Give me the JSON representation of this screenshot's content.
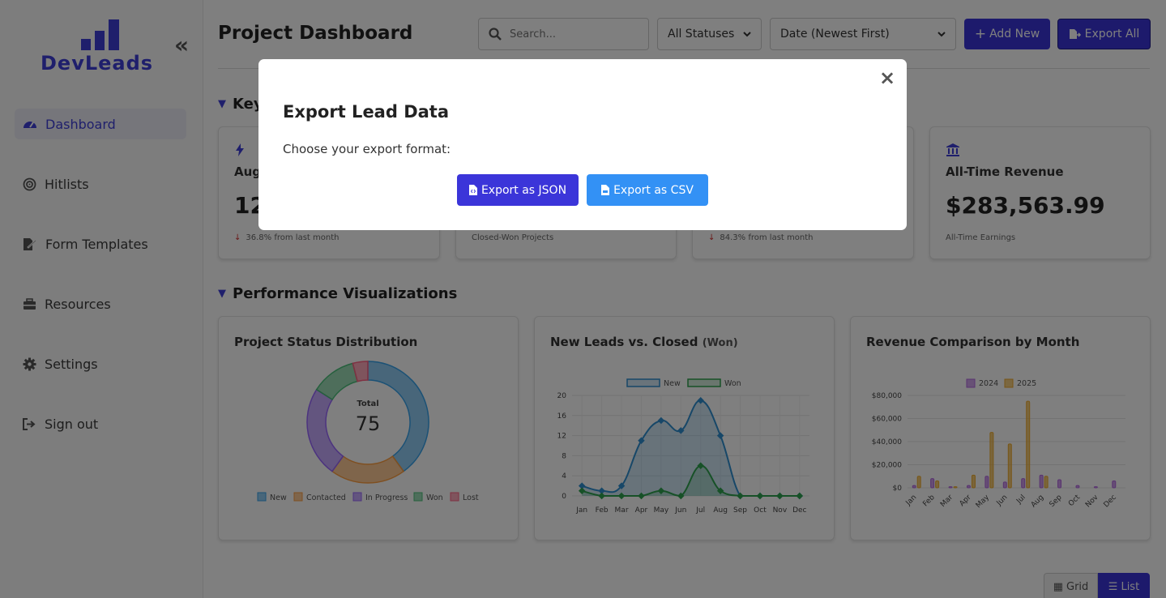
{
  "sidebar": {
    "logo": "DevLeads",
    "collapse": "«",
    "items": [
      {
        "label": "Dashboard"
      },
      {
        "label": "Hitlists"
      },
      {
        "label": "Form Templates"
      },
      {
        "label": "Resources"
      },
      {
        "label": "Settings"
      },
      {
        "label": "Sign out"
      }
    ]
  },
  "header": {
    "title": "Project Dashboard",
    "search_placeholder": "Search...",
    "status_filter": "All Statuses",
    "sort": "Date (Newest First)",
    "add_new": "Add New",
    "export_all": "Export All"
  },
  "sections": {
    "metrics": "Key Metrics",
    "performance": "Performance Visualizations"
  },
  "kpis": [
    {
      "title": "August Leads",
      "value": "12",
      "sub": "36.8% from last month"
    },
    {
      "title": "",
      "value": "",
      "sub": "Closed-Won Projects"
    },
    {
      "title": "",
      "value": "",
      "sub": "84.3% from last month"
    },
    {
      "title": "All-Time Revenue",
      "value": "$283,563.99",
      "sub": "All-Time Earnings"
    }
  ],
  "charts": {
    "status_title": "Project Status Distribution",
    "leads_title": "New Leads vs. Closed",
    "leads_title_suffix": "(Won)",
    "revenue_title": "Revenue Comparison by Month"
  },
  "chart_data": [
    {
      "type": "pie",
      "title": "Project Status Distribution",
      "center_label": "Total",
      "center_value": "75",
      "labels": [
        "New",
        "Contacted",
        "In Progress",
        "Won",
        "Lost"
      ],
      "values": [
        30,
        15,
        18,
        9,
        3
      ],
      "colors": [
        "#36a2eb",
        "#ff9f40",
        "#9966ff",
        "#4bc07a",
        "#ff6384"
      ]
    },
    {
      "type": "line",
      "title": "New Leads vs. Closed (Won)",
      "categories": [
        "Jan",
        "Feb",
        "Mar",
        "Apr",
        "May",
        "Jun",
        "Jul",
        "Aug",
        "Sep",
        "Oct",
        "Nov",
        "Dec"
      ],
      "series": [
        {
          "name": "New",
          "values": [
            2,
            1,
            2,
            11,
            15,
            13,
            19,
            12,
            0,
            0,
            0,
            0
          ],
          "color": "#2f8fd0"
        },
        {
          "name": "Won",
          "values": [
            1,
            0,
            0,
            0,
            1,
            0,
            6,
            1,
            0,
            0,
            0,
            0
          ],
          "color": "#2ea24f"
        }
      ],
      "yticks": [
        "0",
        "4",
        "8",
        "12",
        "16",
        "20"
      ],
      "ylim": [
        0,
        20
      ]
    },
    {
      "type": "bar",
      "title": "Revenue Comparison by Month",
      "categories": [
        "Jan",
        "Feb",
        "Mar",
        "Apr",
        "May",
        "Jun",
        "Jul",
        "Aug",
        "Sep",
        "Oct",
        "Nov",
        "Dec"
      ],
      "series": [
        {
          "name": "2024",
          "values": [
            2000,
            8000,
            1000,
            2000,
            10000,
            5000,
            8000,
            11000,
            7000,
            2000,
            1000,
            6000
          ],
          "color": "#b266e0"
        },
        {
          "name": "2025",
          "values": [
            10000,
            6000,
            1000,
            11000,
            48000,
            38000,
            75000,
            10000,
            0,
            0,
            0,
            0
          ],
          "color": "#f0ad2c"
        }
      ],
      "yticks": [
        "$0",
        "$20,000",
        "$40,000",
        "$60,000",
        "$80,000"
      ],
      "ylim": [
        0,
        80000
      ]
    }
  ],
  "view_toggle": {
    "grid": "Grid",
    "list": "List"
  },
  "modal": {
    "close": "×",
    "title": "Export Lead Data",
    "text": "Choose your export format:",
    "json_button": "Export as JSON",
    "csv_button": "Export as CSV"
  },
  "colors": {
    "accent": "#3b35d9",
    "csv": "#3391f5"
  }
}
